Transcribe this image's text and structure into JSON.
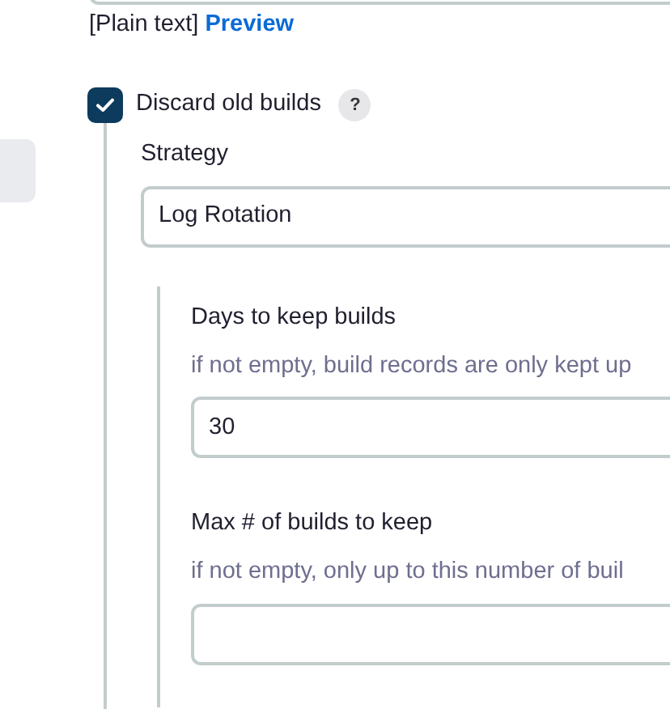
{
  "description_format": {
    "mode": "[Plain text]",
    "preview_link": "Preview"
  },
  "discard_old_builds": {
    "label": "Discard old builds",
    "checked": true,
    "help": "?",
    "strategy": {
      "label": "Strategy",
      "value": "Log Rotation"
    },
    "fields": [
      {
        "label": "Days to keep builds",
        "hint": "if not empty, build records are only kept up",
        "value": "30"
      },
      {
        "label": "Max # of builds to keep",
        "hint": "if not empty, only up to this number of buil"
      }
    ]
  }
}
